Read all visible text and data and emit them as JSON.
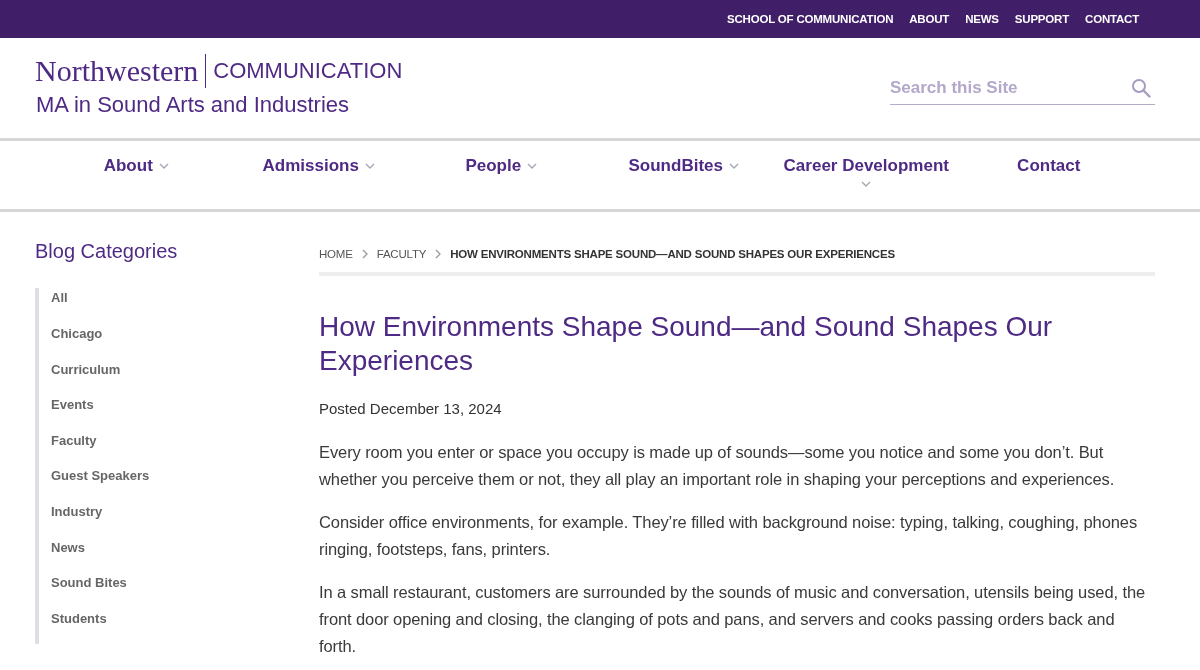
{
  "utility_nav": [
    "SCHOOL OF COMMUNICATION",
    "ABOUT",
    "NEWS",
    "SUPPORT",
    "CONTACT"
  ],
  "header": {
    "wordmark": "Northwestern",
    "school": "COMMUNICATION",
    "program": "MA in Sound Arts and Industries"
  },
  "search": {
    "placeholder": "Search this Site"
  },
  "main_nav": [
    {
      "label": "About",
      "kind": "dropdown"
    },
    {
      "label": "Admissions",
      "kind": "dropdown"
    },
    {
      "label": "People",
      "kind": "dropdown"
    },
    {
      "label": "SoundBites",
      "kind": "dropdown"
    },
    {
      "label": "Career Development",
      "kind": "dropdown-below"
    },
    {
      "label": "Contact",
      "kind": "link"
    }
  ],
  "sidebar": {
    "title": "Blog Categories",
    "items": [
      "All",
      "Chicago",
      "Curriculum",
      "Events",
      "Faculty",
      "Guest Speakers",
      "Industry",
      "News",
      "Sound Bites",
      "Students"
    ]
  },
  "breadcrumb": [
    {
      "label": "HOME",
      "current": false
    },
    {
      "label": "FACULTY",
      "current": false
    },
    {
      "label": "HOW ENVIRONMENTS SHAPE SOUND—AND SOUND SHAPES OUR EXPERIENCES",
      "current": true
    }
  ],
  "article": {
    "title": "How Environments Shape Sound—and Sound Shapes Our Experiences",
    "posted": "Posted December 13, 2024",
    "paragraphs": [
      "Every room you enter or space you occupy is made up of sounds—some you notice and some you don’t. But whether you perceive them or not, they all play an important role in shaping your perceptions and experiences.",
      "Consider office environments, for example. They’re filled with background noise: typing, talking, coughing, phones ringing, footsteps, fans, printers.",
      "In a small restaurant, customers are surrounded by the sounds of music and conversation, utensils being used, the front door opening and closing, the clanging of pots and pans, and servers and cooks passing orders back and forth."
    ]
  }
}
